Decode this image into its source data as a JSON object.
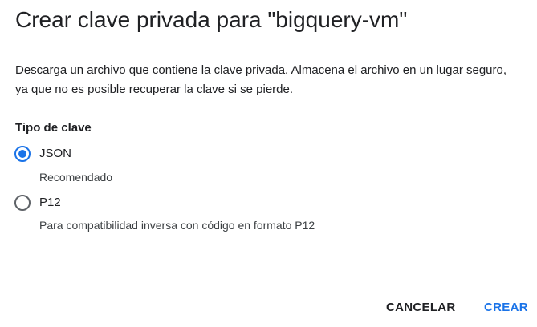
{
  "dialog": {
    "title": "Crear clave privada para \"bigquery-vm\"",
    "description": "Descarga un archivo que contiene la clave privada. Almacena el archivo en un lugar seguro, ya que no es posible recuperar la clave si se pierde.",
    "key_type_label": "Tipo de clave",
    "options": [
      {
        "label": "JSON",
        "hint": "Recomendado",
        "selected": true
      },
      {
        "label": "P12",
        "hint": "Para compatibilidad inversa con código en formato P12",
        "selected": false
      }
    ],
    "actions": {
      "cancel_label": "CANCELAR",
      "create_label": "CREAR"
    },
    "colors": {
      "accent": "#1a73e8",
      "text": "#202124",
      "secondary_text": "#3c4043",
      "radio_unselected": "#5f6368"
    }
  }
}
